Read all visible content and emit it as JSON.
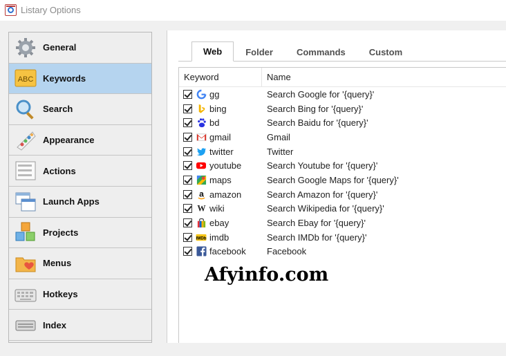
{
  "window": {
    "title": "Listary Options"
  },
  "sidebar": {
    "items": [
      {
        "label": "General",
        "icon": "gear-icon",
        "active": false
      },
      {
        "label": "Keywords",
        "icon": "abc-icon",
        "active": true
      },
      {
        "label": "Search",
        "icon": "magnifier-icon",
        "active": false
      },
      {
        "label": "Appearance",
        "icon": "palette-icon",
        "active": false
      },
      {
        "label": "Actions",
        "icon": "actions-icon",
        "active": false
      },
      {
        "label": "Launch Apps",
        "icon": "windows-icon",
        "active": false
      },
      {
        "label": "Projects",
        "icon": "cubes-icon",
        "active": false
      },
      {
        "label": "Menus",
        "icon": "heart-folder-icon",
        "active": false
      },
      {
        "label": "Hotkeys",
        "icon": "keyboard-icon",
        "active": false
      },
      {
        "label": "Index",
        "icon": "drive-icon",
        "active": false
      }
    ]
  },
  "tabs": [
    {
      "label": "Web",
      "active": true
    },
    {
      "label": "Folder",
      "active": false
    },
    {
      "label": "Commands",
      "active": false
    },
    {
      "label": "Custom",
      "active": false
    }
  ],
  "table": {
    "headers": {
      "keyword": "Keyword",
      "name": "Name"
    },
    "rows": [
      {
        "keyword": "gg",
        "name": "Search Google for '{query}'",
        "icon": "google-icon",
        "checked": true
      },
      {
        "keyword": "bing",
        "name": "Search Bing for '{query}'",
        "icon": "bing-icon",
        "checked": true
      },
      {
        "keyword": "bd",
        "name": "Search Baidu for '{query}'",
        "icon": "baidu-icon",
        "checked": true
      },
      {
        "keyword": "gmail",
        "name": "Gmail",
        "icon": "gmail-icon",
        "checked": true
      },
      {
        "keyword": "twitter",
        "name": "Twitter",
        "icon": "twitter-icon",
        "checked": true
      },
      {
        "keyword": "youtube",
        "name": "Search Youtube for '{query}'",
        "icon": "youtube-icon",
        "checked": true
      },
      {
        "keyword": "maps",
        "name": "Search Google Maps for '{query}'",
        "icon": "maps-icon",
        "checked": true
      },
      {
        "keyword": "amazon",
        "name": "Search Amazon for '{query}'",
        "icon": "amazon-icon",
        "checked": true
      },
      {
        "keyword": "wiki",
        "name": "Search Wikipedia for '{query}'",
        "icon": "wikipedia-icon",
        "checked": true
      },
      {
        "keyword": "ebay",
        "name": "Search Ebay for '{query}'",
        "icon": "ebay-icon",
        "checked": true
      },
      {
        "keyword": "imdb",
        "name": "Search IMDb for '{query}'",
        "icon": "imdb-icon",
        "checked": true
      },
      {
        "keyword": "facebook",
        "name": "Facebook",
        "icon": "facebook-icon",
        "checked": true
      }
    ]
  },
  "watermark": "Afyinfo.com",
  "colors": {
    "accent": "#b5d4ef",
    "sidebar_bg": "#eeeeee",
    "window_bg": "#f0f0f0"
  }
}
